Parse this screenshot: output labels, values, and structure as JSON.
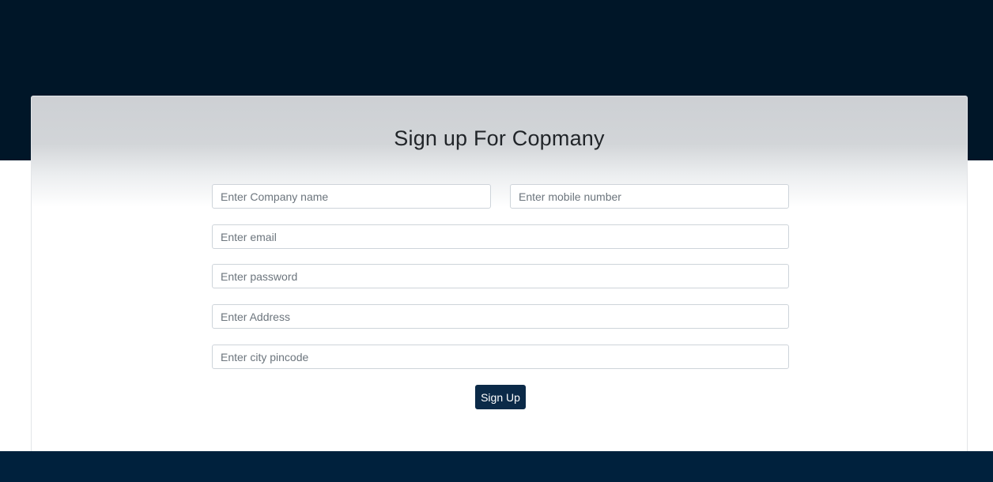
{
  "form": {
    "title": "Sign up For Copmany",
    "company_name_placeholder": "Enter Company name",
    "mobile_placeholder": "Enter mobile number",
    "email_placeholder": "Enter email",
    "password_placeholder": "Enter password",
    "address_placeholder": "Enter Address",
    "pincode_placeholder": "Enter city pincode",
    "submit_label": "Sign Up"
  },
  "colors": {
    "header_band": "#001628",
    "footer_band": "#00213d",
    "button": "#0b2a48"
  }
}
